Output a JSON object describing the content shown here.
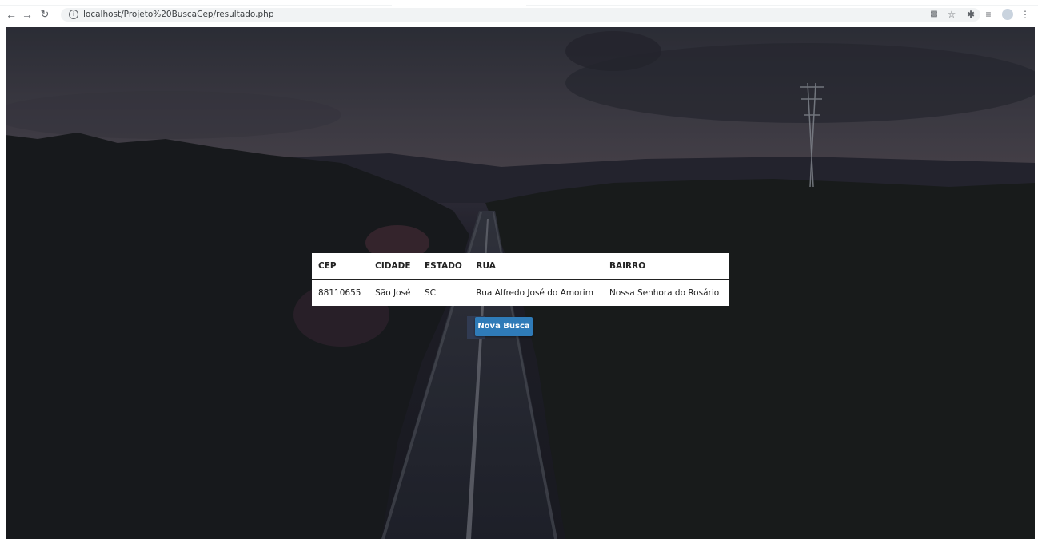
{
  "browser": {
    "url": "localhost/Projeto%20BuscaCep/resultado.php",
    "icons": [
      "back-arrow-icon",
      "forward-arrow-icon",
      "reload-icon",
      "info-icon",
      "translate-icon",
      "star-icon",
      "extensions-icon",
      "reading-list-icon",
      "profile-avatar-icon",
      "menu-icon"
    ]
  },
  "table": {
    "headers": {
      "cep": "CEP",
      "cidade": "CIDADE",
      "estado": "ESTADO",
      "rua": "RUA",
      "bairro": "BAIRRO"
    },
    "rows": [
      {
        "cep": "88110655",
        "cidade": "São José",
        "estado": "SC",
        "rua": "Rua Alfredo José do Amorim",
        "bairro": "Nossa Senhora do Rosário"
      }
    ]
  },
  "button": {
    "label": "Nova Busca",
    "color": "#2f7bb8"
  },
  "colors": {
    "overlay": "#1c1d23",
    "table_bg": "#ffffff"
  }
}
